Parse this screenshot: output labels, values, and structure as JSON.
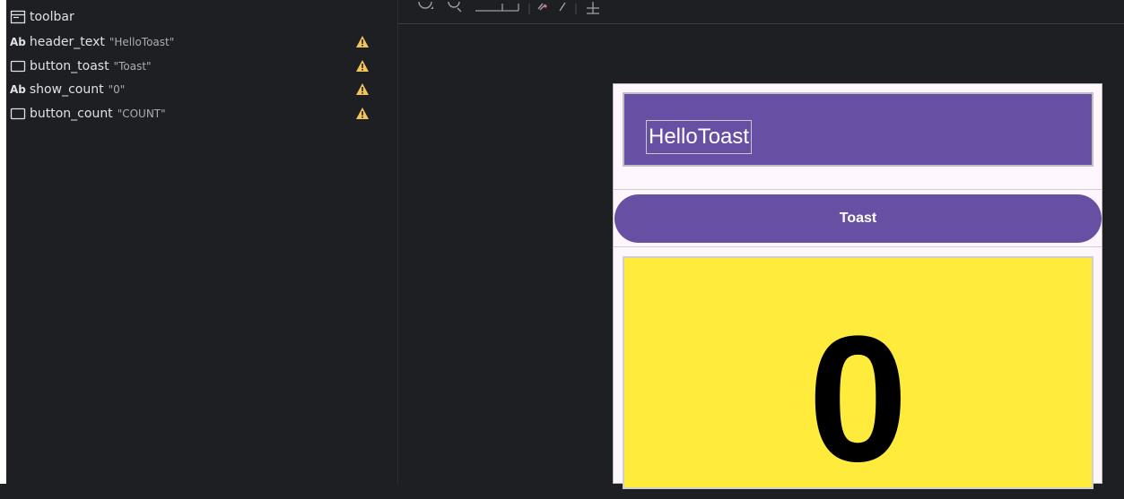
{
  "component_tree": {
    "items": [
      {
        "icon": "toolbar-icon",
        "prefix": "",
        "name": "toolbar",
        "value": "",
        "warning": false
      },
      {
        "icon": "textview-icon",
        "prefix": "Ab",
        "name": "header_text",
        "value": "\"HelloToast\"",
        "warning": true
      },
      {
        "icon": "button-icon",
        "prefix": "",
        "name": "button_toast",
        "value": "\"Toast\"",
        "warning": true
      },
      {
        "icon": "textview-icon",
        "prefix": "Ab",
        "name": "show_count",
        "value": "\"0\"",
        "warning": true
      },
      {
        "icon": "button-icon",
        "prefix": "",
        "name": "button_count",
        "value": "\"COUNT\"",
        "warning": true
      }
    ]
  },
  "preview": {
    "header_text": "HelloToast",
    "button_toast": "Toast",
    "show_count": "0"
  },
  "colors": {
    "primary": "#6750a4",
    "count_background": "#ffeb3b",
    "warning": "#f2c55c",
    "panel_background": "#1e1f22"
  }
}
